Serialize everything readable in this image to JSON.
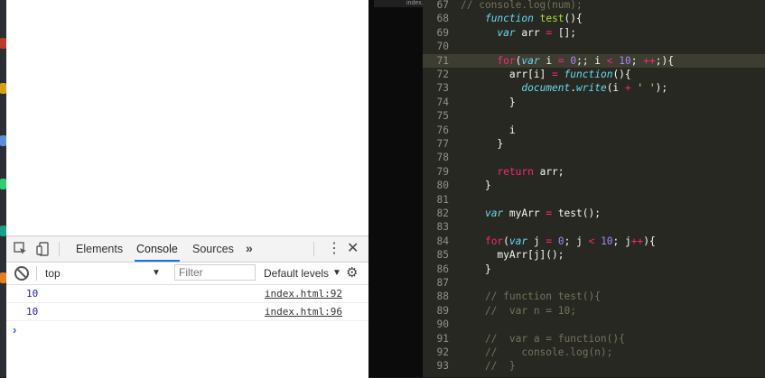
{
  "devtools": {
    "tabs": [
      "Elements",
      "Console",
      "Sources"
    ],
    "active_tab": "Console",
    "more_label": "»",
    "kebab_label": "⋮",
    "close_label": "✕",
    "context": "top",
    "filter_placeholder": "Filter",
    "levels_label": "Default levels",
    "messages": [
      {
        "value": "10",
        "source": "index.html:92"
      },
      {
        "value": "10",
        "source": "index.html:96"
      }
    ],
    "prompt": "›"
  },
  "mid_tab_label": "index.h",
  "editor": {
    "highlight_line": 71,
    "lines": [
      {
        "n": "67",
        "t": [
          [
            "cm",
            "// console.log(num);"
          ]
        ]
      },
      {
        "n": "68",
        "t": [
          [
            "tx",
            "    "
          ],
          [
            "st",
            "function"
          ],
          [
            "tx",
            " "
          ],
          [
            "fn",
            "test"
          ],
          [
            "tx",
            "(){"
          ]
        ]
      },
      {
        "n": "69",
        "t": [
          [
            "tx",
            "      "
          ],
          [
            "st",
            "var"
          ],
          [
            "tx",
            " arr "
          ],
          [
            "kw",
            "="
          ],
          [
            "tx",
            " [];"
          ]
        ]
      },
      {
        "n": "70",
        "t": [
          [
            "tx",
            ""
          ]
        ]
      },
      {
        "n": "71",
        "t": [
          [
            "tx",
            "      "
          ],
          [
            "kw",
            "for"
          ],
          [
            "tx",
            "("
          ],
          [
            "st",
            "var"
          ],
          [
            "tx",
            " i "
          ],
          [
            "kw",
            "="
          ],
          [
            "tx",
            " "
          ],
          [
            "nu",
            "0"
          ],
          [
            "tx",
            ";; i "
          ],
          [
            "kw",
            "<"
          ],
          [
            "tx",
            " "
          ],
          [
            "nu",
            "10"
          ],
          [
            "tx",
            "; "
          ],
          [
            "kw",
            "++"
          ],
          [
            "tx",
            ";){"
          ]
        ]
      },
      {
        "n": "72",
        "t": [
          [
            "tx",
            "        arr[i] "
          ],
          [
            "kw",
            "="
          ],
          [
            "tx",
            " "
          ],
          [
            "st",
            "function"
          ],
          [
            "tx",
            "(){"
          ]
        ]
      },
      {
        "n": "73",
        "t": [
          [
            "tx",
            "          "
          ],
          [
            "st",
            "document"
          ],
          [
            "tx",
            "."
          ],
          [
            "st",
            "write"
          ],
          [
            "tx",
            "(i "
          ],
          [
            "kw",
            "+"
          ],
          [
            "tx",
            " "
          ],
          [
            "str",
            "' '"
          ],
          [
            "tx",
            ");"
          ]
        ]
      },
      {
        "n": "74",
        "t": [
          [
            "tx",
            "        }"
          ]
        ]
      },
      {
        "n": "75",
        "t": [
          [
            "tx",
            ""
          ]
        ]
      },
      {
        "n": "76",
        "t": [
          [
            "tx",
            "        i"
          ]
        ]
      },
      {
        "n": "77",
        "t": [
          [
            "tx",
            "      }"
          ]
        ]
      },
      {
        "n": "78",
        "t": [
          [
            "tx",
            ""
          ]
        ]
      },
      {
        "n": "79",
        "t": [
          [
            "tx",
            "      "
          ],
          [
            "kw",
            "return"
          ],
          [
            "tx",
            " arr;"
          ]
        ]
      },
      {
        "n": "80",
        "t": [
          [
            "tx",
            "    }"
          ]
        ]
      },
      {
        "n": "81",
        "t": [
          [
            "tx",
            ""
          ]
        ]
      },
      {
        "n": "82",
        "t": [
          [
            "tx",
            "    "
          ],
          [
            "st",
            "var"
          ],
          [
            "tx",
            " myArr "
          ],
          [
            "kw",
            "="
          ],
          [
            "tx",
            " test();"
          ]
        ]
      },
      {
        "n": "83",
        "t": [
          [
            "tx",
            ""
          ]
        ]
      },
      {
        "n": "84",
        "t": [
          [
            "tx",
            "    "
          ],
          [
            "kw",
            "for"
          ],
          [
            "tx",
            "("
          ],
          [
            "st",
            "var"
          ],
          [
            "tx",
            " j "
          ],
          [
            "kw",
            "="
          ],
          [
            "tx",
            " "
          ],
          [
            "nu",
            "0"
          ],
          [
            "tx",
            "; j "
          ],
          [
            "kw",
            "<"
          ],
          [
            "tx",
            " "
          ],
          [
            "nu",
            "10"
          ],
          [
            "tx",
            "; j"
          ],
          [
            "kw",
            "++"
          ],
          [
            "tx",
            "){"
          ]
        ]
      },
      {
        "n": "85",
        "t": [
          [
            "tx",
            "      myArr[j]();"
          ]
        ]
      },
      {
        "n": "86",
        "t": [
          [
            "tx",
            "    }"
          ]
        ]
      },
      {
        "n": "87",
        "t": [
          [
            "tx",
            ""
          ]
        ]
      },
      {
        "n": "88",
        "t": [
          [
            "cm",
            "    // function test(){"
          ]
        ]
      },
      {
        "n": "89",
        "t": [
          [
            "cm",
            "    //  var n = 10;"
          ]
        ]
      },
      {
        "n": "90",
        "t": [
          [
            "tx",
            ""
          ]
        ]
      },
      {
        "n": "91",
        "t": [
          [
            "cm",
            "    //  var a = function(){"
          ]
        ]
      },
      {
        "n": "92",
        "t": [
          [
            "cm",
            "    //    console.log(n);"
          ]
        ]
      },
      {
        "n": "93",
        "t": [
          [
            "cm",
            "    //  }"
          ]
        ]
      }
    ]
  },
  "colors": {
    "editor_bg": "#272822",
    "keyword": "#f92672",
    "function_name": "#a6e22e",
    "storage": "#66d9ef",
    "number": "#ae81ff",
    "comment": "#75715e",
    "console_value": "#1a1aa6",
    "active_tab_underline": "#1a73e8"
  }
}
